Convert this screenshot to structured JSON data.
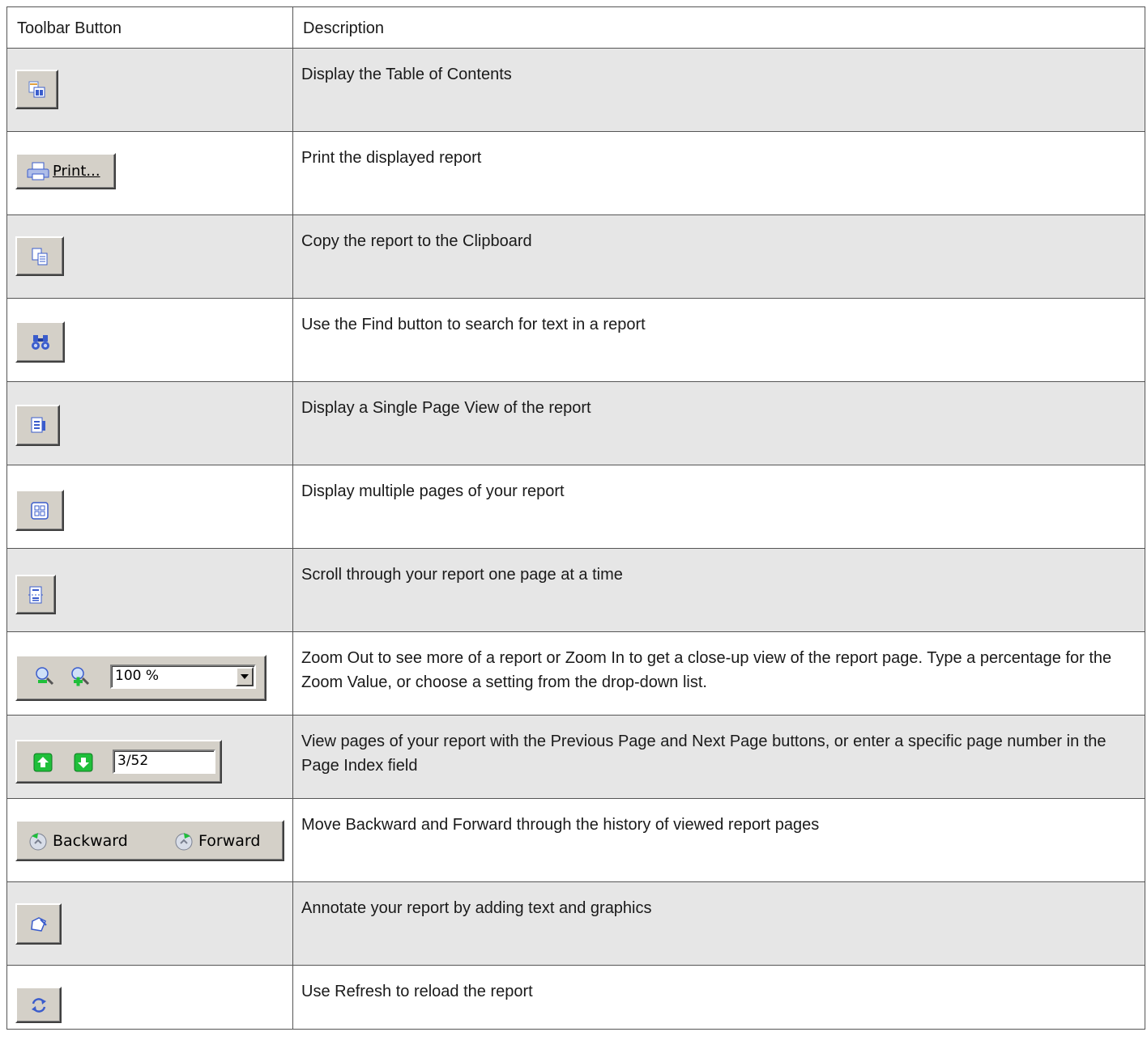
{
  "headers": {
    "col1": "Toolbar Button",
    "col2": "Description"
  },
  "rows": [
    {
      "icon": "table-of-contents-icon",
      "description": "Display the Table of Contents"
    },
    {
      "icon": "print-icon",
      "button_label": "Print...",
      "description": "Print the displayed report"
    },
    {
      "icon": "copy-icon",
      "description": "Copy the report to the Clipboard"
    },
    {
      "icon": "find-binoculars-icon",
      "description": "Use the Find button to search for text in a report"
    },
    {
      "icon": "single-page-icon",
      "description": "Display a Single Page View of the report"
    },
    {
      "icon": "multiple-pages-icon",
      "description": "Display multiple pages of your report"
    },
    {
      "icon": "continuous-scroll-icon",
      "description": "Scroll through your report one page at a time"
    },
    {
      "icon": "zoom-icons",
      "zoom_value": "100 %",
      "description": "Zoom Out to see more of a report or Zoom In to get a close-up view of the report page. Type a percentage for the Zoom Value, or choose a setting from the drop-down list."
    },
    {
      "icon": "page-navigation-icons",
      "page_index": "3/52",
      "description": "View pages of your report with the Previous Page and Next Page buttons, or enter a specific page number in the Page Index field"
    },
    {
      "icon": "history-icons",
      "backward_label": "Backward",
      "forward_label": "Forward",
      "description": "Move Backward and Forward through the history of viewed report pages"
    },
    {
      "icon": "annotate-icon",
      "description": "Annotate your report by adding text and graphics"
    },
    {
      "icon": "refresh-icon",
      "description": "Use Refresh to reload the report"
    }
  ],
  "colors": {
    "shaded_row": "#e6e6e6",
    "button_face": "#d4d0c8",
    "icon_blue": "#3a5ccc",
    "icon_green": "#1fbf3a"
  }
}
